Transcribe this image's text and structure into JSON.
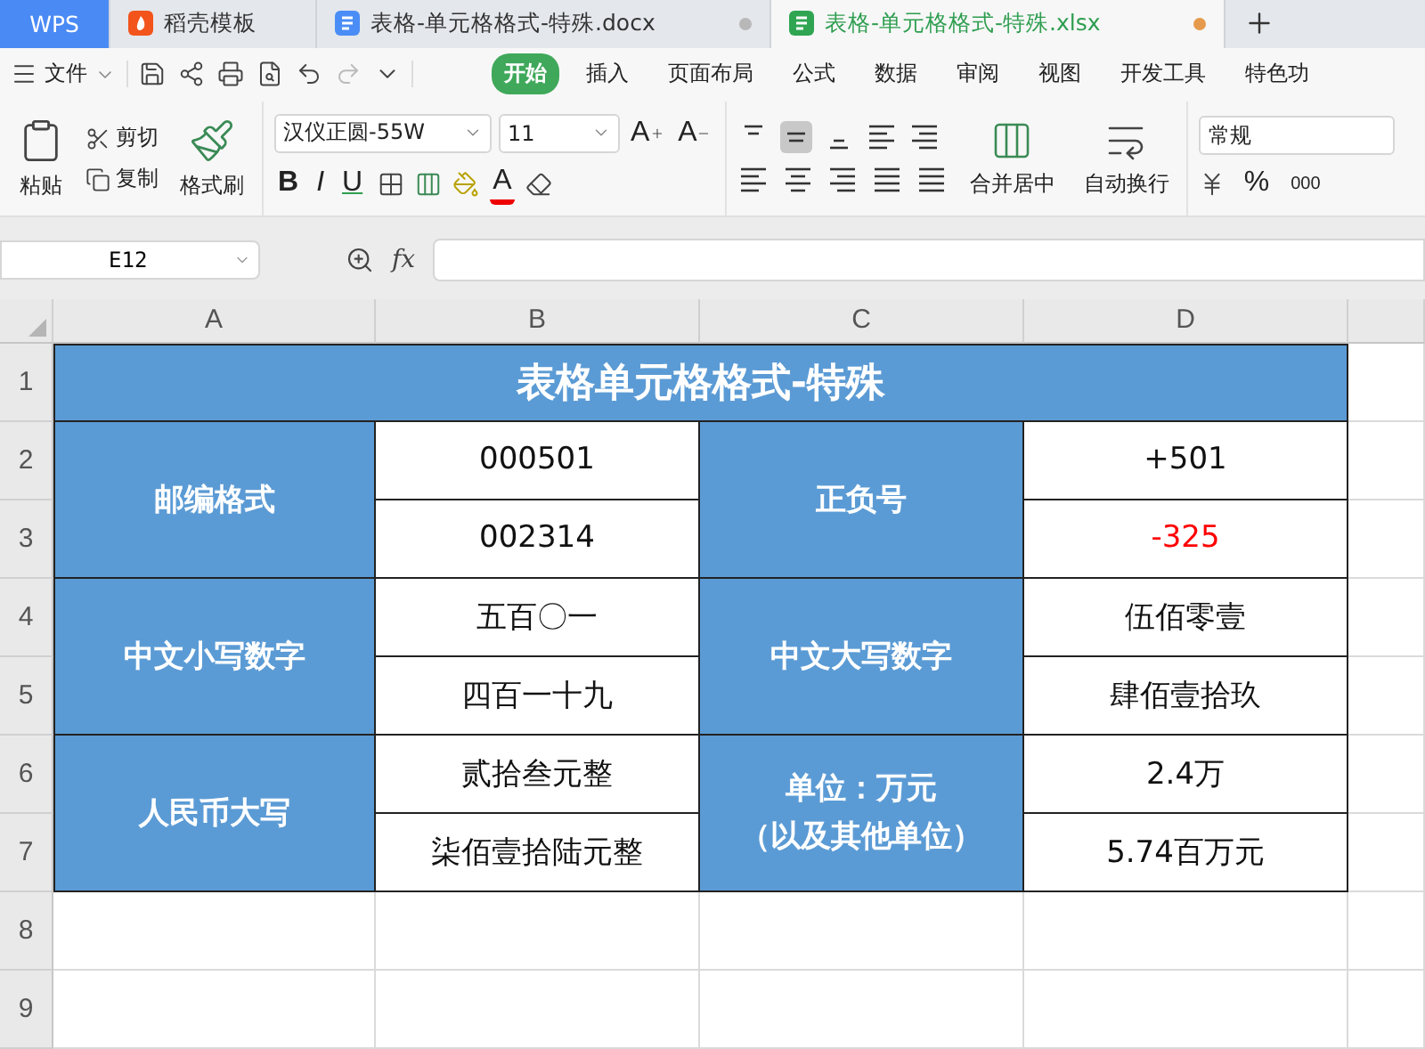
{
  "tabs": [
    {
      "label": "WPS",
      "kind": "home",
      "selected": false
    },
    {
      "label": "稻壳模板",
      "kind": "docer",
      "selected": false
    },
    {
      "label": "表格-单元格格式-特殊.docx",
      "kind": "writer",
      "selected": false,
      "modified": false
    },
    {
      "label": "表格-单元格格式-特殊.xlsx",
      "kind": "sheet",
      "selected": true,
      "modified": true
    }
  ],
  "menu": {
    "file": "文件",
    "ribbon_tabs": [
      {
        "label": "开始",
        "selected": true
      },
      {
        "label": "插入",
        "selected": false
      },
      {
        "label": "页面布局",
        "selected": false
      },
      {
        "label": "公式",
        "selected": false
      },
      {
        "label": "数据",
        "selected": false
      },
      {
        "label": "审阅",
        "selected": false
      },
      {
        "label": "视图",
        "selected": false
      },
      {
        "label": "开发工具",
        "selected": false
      },
      {
        "label": "特色功",
        "selected": false
      }
    ]
  },
  "ribbon": {
    "paste": "粘贴",
    "cut": "剪切",
    "copy": "复制",
    "format_painter": "格式刷",
    "font_name": "汉仪正圆-55W",
    "font_size": "11",
    "grow": "A",
    "shrink": "A",
    "bold": "B",
    "italic": "I",
    "underline": "U",
    "font_color": "A",
    "merge": "合并居中",
    "wrap": "自动换行",
    "number_format": "常规",
    "percent": "%",
    "thousands": "000"
  },
  "formula_bar": {
    "name_box": "E12",
    "fx": "fx"
  },
  "sheet": {
    "columns": [
      "A",
      "B",
      "C",
      "D"
    ],
    "row_numbers": [
      "1",
      "2",
      "3",
      "4",
      "5",
      "6",
      "7",
      "8",
      "9"
    ],
    "title": "表格单元格格式-特殊",
    "pairs": [
      {
        "left": {
          "lines": [
            "邮编格式"
          ],
          "values": [
            {
              "text": "000501",
              "negative": false
            },
            {
              "text": "002314",
              "negative": false
            }
          ]
        },
        "right": {
          "lines": [
            "正负号"
          ],
          "values": [
            {
              "text": "+501",
              "negative": false
            },
            {
              "text": "-325",
              "negative": true
            }
          ]
        }
      },
      {
        "left": {
          "lines": [
            "中文小写数字"
          ],
          "values": [
            {
              "text": "五百〇一",
              "negative": false
            },
            {
              "text": "四百一十九",
              "negative": false
            }
          ]
        },
        "right": {
          "lines": [
            "中文大写数字"
          ],
          "values": [
            {
              "text": "伍佰零壹",
              "negative": false
            },
            {
              "text": "肆佰壹拾玖",
              "negative": false
            }
          ]
        }
      },
      {
        "left": {
          "lines": [
            "人民币大写"
          ],
          "values": [
            {
              "text": "贰拾叁元整",
              "negative": false
            },
            {
              "text": "柒佰壹拾陆元整",
              "negative": false
            }
          ]
        },
        "right": {
          "lines": [
            "单位：万元",
            "（以及其他单位）"
          ],
          "values": [
            {
              "text": "2.4万",
              "negative": false
            },
            {
              "text": "5.74百万元",
              "negative": false
            }
          ]
        }
      }
    ]
  }
}
